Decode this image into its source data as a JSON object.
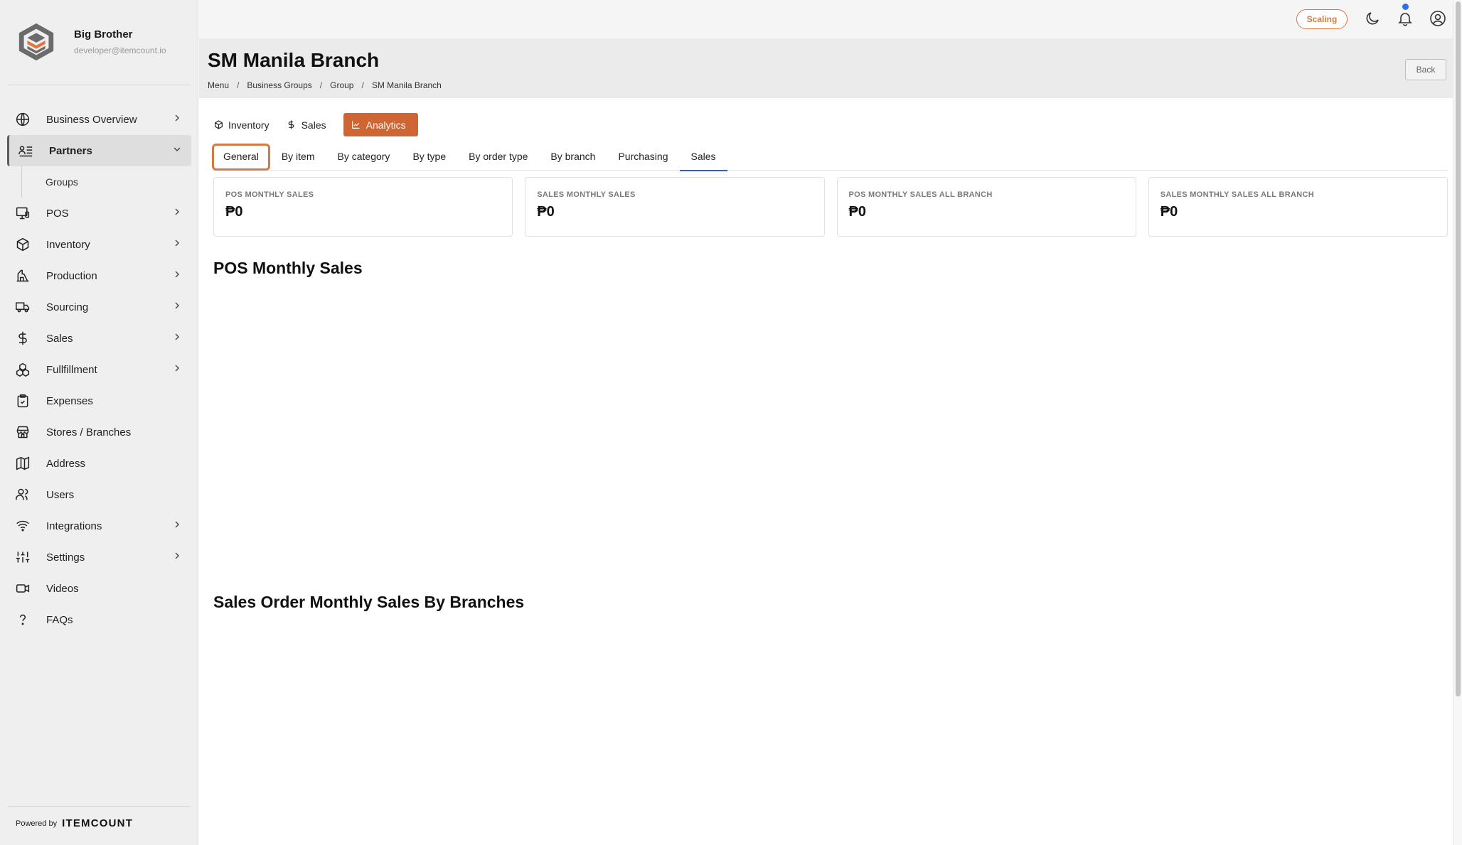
{
  "brand": {
    "name": "Big Brother",
    "email": "developer@itemcount.io"
  },
  "sidebar": {
    "items": [
      {
        "label": "Business Overview",
        "icon": "globe-icon",
        "chevron": "right"
      },
      {
        "label": "Partners",
        "icon": "partners-list-icon",
        "chevron": "down",
        "active": true
      },
      {
        "label": "POS",
        "icon": "pos-terminal-icon",
        "chevron": "right"
      },
      {
        "label": "Inventory",
        "icon": "box-icon",
        "chevron": "right"
      },
      {
        "label": "Production",
        "icon": "factory-icon",
        "chevron": "right"
      },
      {
        "label": "Sourcing",
        "icon": "truck-icon",
        "chevron": "right"
      },
      {
        "label": "Sales",
        "icon": "dollar-icon",
        "chevron": "right"
      },
      {
        "label": "Fullfillment",
        "icon": "boxes-icon",
        "chevron": "right"
      },
      {
        "label": "Expenses",
        "icon": "clipboard-icon"
      },
      {
        "label": "Stores / Branches",
        "icon": "store-icon"
      },
      {
        "label": "Address",
        "icon": "map-icon"
      },
      {
        "label": "Users",
        "icon": "users-icon"
      },
      {
        "label": "Integrations",
        "icon": "wifi-icon",
        "chevron": "right"
      },
      {
        "label": "Settings",
        "icon": "sliders-icon",
        "chevron": "right"
      },
      {
        "label": "Videos",
        "icon": "video-icon"
      },
      {
        "label": "FAQs",
        "icon": "question-icon"
      }
    ],
    "subitem": "Groups",
    "powered_by": "Powered by",
    "powered_brand": "ITEMCOUNT"
  },
  "topbar": {
    "scaling_label": "Scaling"
  },
  "header": {
    "title": "SM Manila Branch",
    "breadcrumb": [
      "Menu",
      "Business Groups",
      "Group",
      "SM Manila Branch"
    ],
    "back_label": "Back"
  },
  "main_tabs": [
    {
      "label": "Inventory",
      "icon": "box-icon"
    },
    {
      "label": "Sales",
      "icon": "dollar-icon"
    },
    {
      "label": "Analytics",
      "icon": "chart-icon",
      "active": true
    }
  ],
  "sub_tabs": [
    "General",
    "By item",
    "By category",
    "By type",
    "By order type",
    "By branch",
    "Purchasing",
    "Sales"
  ],
  "cards": [
    {
      "label": "POS MONTHLY SALES",
      "value": "₱0"
    },
    {
      "label": "SALES MONTHLY SALES",
      "value": "₱0"
    },
    {
      "label": "POS MONTHLY SALES ALL BRANCH",
      "value": "₱0"
    },
    {
      "label": "SALES MONTHLY SALES ALL BRANCH",
      "value": "₱0"
    }
  ],
  "sections": {
    "pos_monthly": "POS Monthly Sales",
    "sales_order_by_branches": "Sales Order Monthly Sales By Branches"
  },
  "colors": {
    "accent": "#cf6532",
    "link": "#2f5fc4",
    "notification": "#2f6fe0"
  }
}
